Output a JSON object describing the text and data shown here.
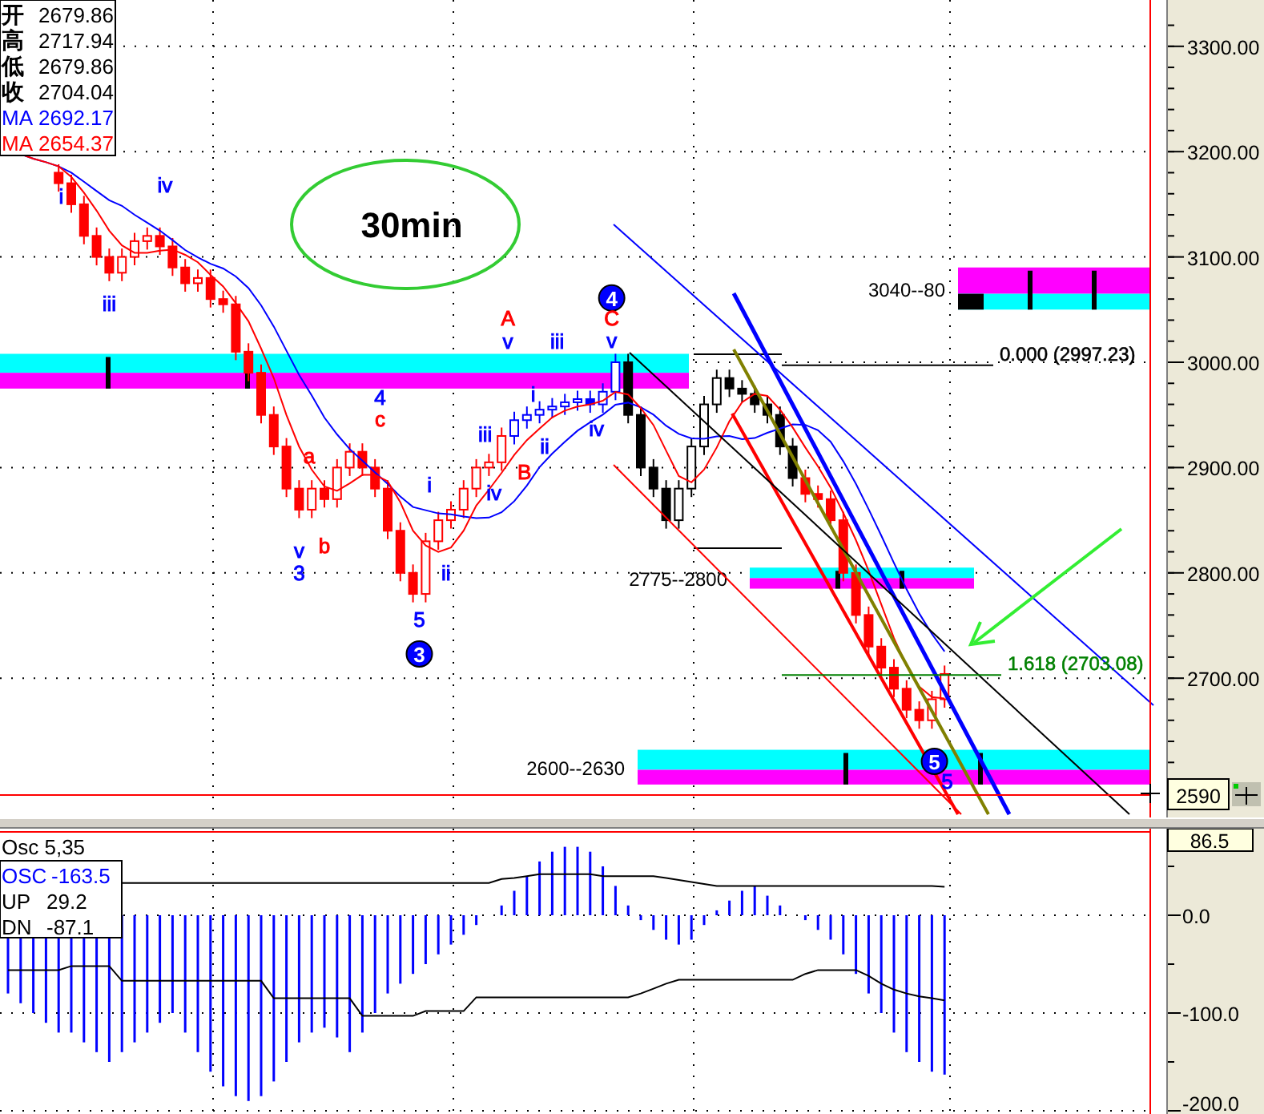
{
  "price_info": [
    {
      "kind": "ohlc",
      "label": "开",
      "value": "2679.86",
      "color": "#000000"
    },
    {
      "kind": "ohlc",
      "label": "高",
      "value": "2717.94",
      "color": "#000000"
    },
    {
      "kind": "ohlc",
      "label": "低",
      "value": "2679.86",
      "color": "#000000"
    },
    {
      "kind": "ohlc",
      "label": "收",
      "value": "2704.04",
      "color": "#000000"
    },
    {
      "kind": "ma",
      "label": "MA",
      "value": "2692.17",
      "color": "#0000ff"
    },
    {
      "kind": "ma",
      "label": "MA",
      "value": "2654.37",
      "color": "#ff0000"
    }
  ],
  "title": "30min",
  "wave_labels": [
    {
      "kind": "label",
      "text": "i",
      "color": "#0000ff"
    },
    {
      "kind": "label",
      "text": "iii",
      "color": "#0000ff"
    },
    {
      "kind": "label",
      "text": "iv",
      "color": "#0000ff"
    },
    {
      "kind": "circle",
      "text": "4",
      "color": "#0000ff"
    },
    {
      "kind": "label",
      "text": "C",
      "color": "#ff0000"
    },
    {
      "kind": "label",
      "text": "v",
      "color": "#0000ff"
    },
    {
      "kind": "label",
      "text": "A",
      "color": "#ff0000"
    },
    {
      "kind": "label",
      "text": "v",
      "color": "#0000ff"
    },
    {
      "kind": "label",
      "text": "iii",
      "color": "#0000ff"
    },
    {
      "kind": "label",
      "text": "i",
      "color": "#0000ff"
    },
    {
      "kind": "label",
      "text": "iv",
      "color": "#0000ff"
    },
    {
      "kind": "label",
      "text": "4",
      "color": "#0000ff"
    },
    {
      "kind": "label",
      "text": "c",
      "color": "#ff0000"
    },
    {
      "kind": "label",
      "text": "a",
      "color": "#ff0000"
    },
    {
      "kind": "label",
      "text": "iii",
      "color": "#0000ff"
    },
    {
      "kind": "label",
      "text": "ii",
      "color": "#0000ff"
    },
    {
      "kind": "label",
      "text": "B",
      "color": "#ff0000"
    },
    {
      "kind": "label",
      "text": "iv",
      "color": "#0000ff"
    },
    {
      "kind": "label",
      "text": "i",
      "color": "#0000ff"
    },
    {
      "kind": "label",
      "text": "v",
      "color": "#0000ff"
    },
    {
      "kind": "label",
      "text": "3",
      "color": "#0000ff"
    },
    {
      "kind": "label",
      "text": "b",
      "color": "#ff0000"
    },
    {
      "kind": "label",
      "text": "ii",
      "color": "#0000ff"
    },
    {
      "kind": "label",
      "text": "5",
      "color": "#0000ff"
    },
    {
      "kind": "circle",
      "text": "3",
      "color": "#0000ff"
    },
    {
      "kind": "circle",
      "text": "5",
      "color": "#0000ff"
    },
    {
      "kind": "label",
      "text": "5",
      "color": "#0000ff"
    }
  ],
  "zone_labels": [
    "3040--80",
    "2775--2800",
    "2600--2630"
  ],
  "fib_levels": [
    {
      "text": "0.000 (2997.23)",
      "color": "#000000"
    },
    {
      "text": "1.618 (2703.08)",
      "color": "#008000"
    }
  ],
  "price_axis": {
    "ticks": [
      "3300.00",
      "3200.00",
      "3100.00",
      "3000.00",
      "2900.00",
      "2800.00",
      "2700.00"
    ],
    "current_price": "2590"
  },
  "oscillator": {
    "title": "Osc 5,35",
    "top_value": "86.5",
    "readings": [
      {
        "label": "OSC",
        "value": "-163.5",
        "color": "#0000ff"
      },
      {
        "label": "UP",
        "value": "29.2",
        "color": "#000000"
      },
      {
        "label": "DN",
        "value": "-87.1",
        "color": "#000000"
      }
    ],
    "ticks": [
      "0.0",
      "-100.0",
      "-200.0"
    ]
  }
}
